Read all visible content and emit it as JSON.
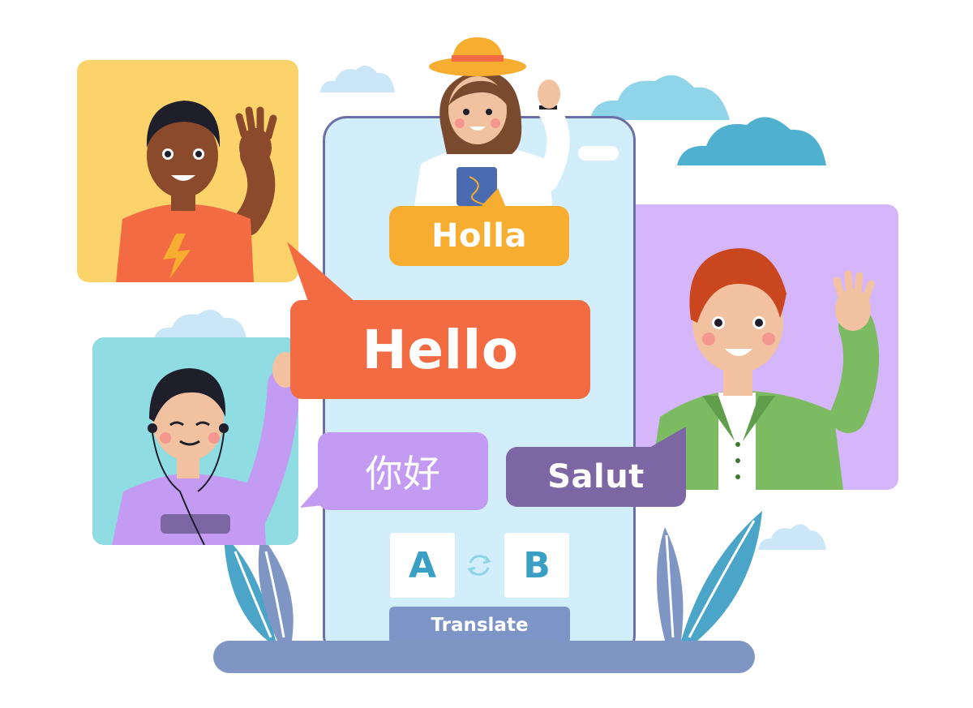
{
  "bubbles": {
    "holla": "Holla",
    "hello": "Hello",
    "nihao": "你好",
    "salut": "Salut"
  },
  "translator": {
    "source_lang": "A",
    "target_lang": "B",
    "translate_label": "Translate"
  },
  "colors": {
    "phone_screen": "#d2eefb",
    "holla_bubble": "#f7ad2f",
    "hello_bubble": "#f26b43",
    "nihao_bubble": "#c49bf2",
    "salut_bubble": "#7d66a4",
    "translate_button": "#7d95c6",
    "lang_letter": "#3a9fc4"
  },
  "icons": [
    "swap-icon",
    "lightning-icon",
    "headphones-icon",
    "hat-icon",
    "book-icon",
    "leaf-icon",
    "cloud-icon"
  ]
}
